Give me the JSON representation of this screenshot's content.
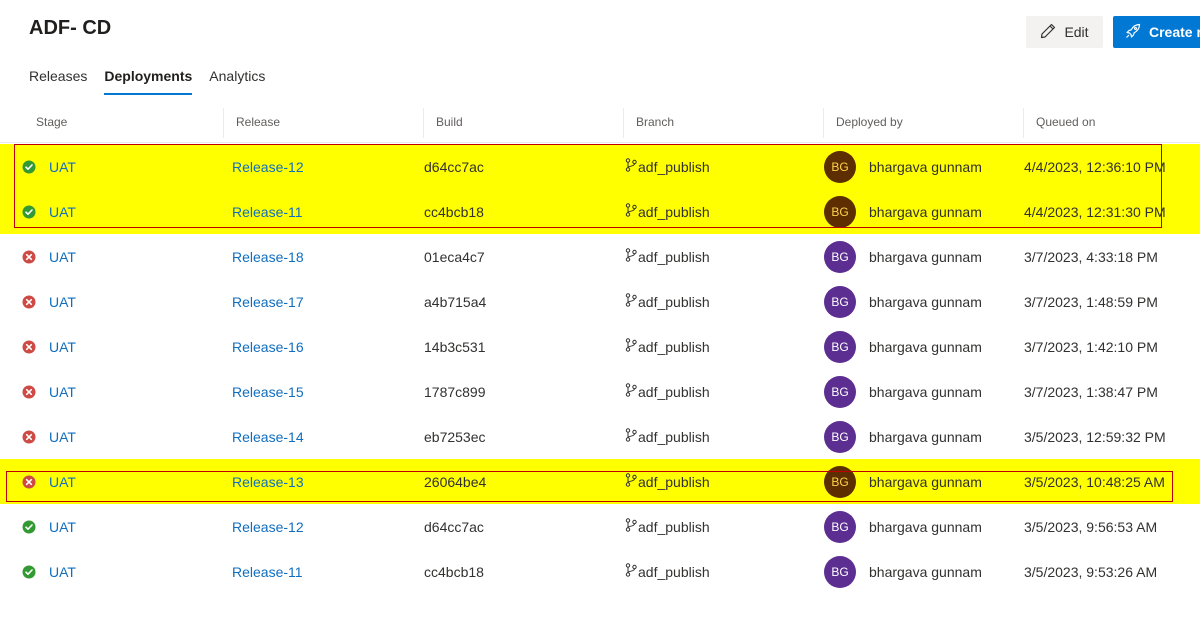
{
  "page": {
    "title": "ADF- CD"
  },
  "toolbar": {
    "edit_label": "Edit",
    "create_label": "Create release"
  },
  "tabs": [
    {
      "label": "Releases"
    },
    {
      "label": "Deployments"
    },
    {
      "label": "Analytics"
    }
  ],
  "table": {
    "headers": [
      "Stage",
      "Release",
      "Build",
      "Branch",
      "Deployed by",
      "Queued on"
    ],
    "rows": [
      {
        "status": "succeeded",
        "stage": "UAT",
        "release": "Release-12",
        "build": "d64cc7ac",
        "branch": "adf_publish",
        "initials": "BG",
        "deployed_by": "bhargava gunnam",
        "queued_on": "4/4/2023, 12:36:10 PM",
        "highlighted": true
      },
      {
        "status": "succeeded",
        "stage": "UAT",
        "release": "Release-11",
        "build": "cc4bcb18",
        "branch": "adf_publish",
        "initials": "BG",
        "deployed_by": "bhargava gunnam",
        "queued_on": "4/4/2023, 12:31:30 PM",
        "highlighted": true
      },
      {
        "status": "failed",
        "stage": "UAT",
        "release": "Release-18",
        "build": "01eca4c7",
        "branch": "adf_publish",
        "initials": "BG",
        "deployed_by": "bhargava gunnam",
        "queued_on": "3/7/2023, 4:33:18 PM",
        "highlighted": false
      },
      {
        "status": "failed",
        "stage": "UAT",
        "release": "Release-17",
        "build": "a4b715a4",
        "branch": "adf_publish",
        "initials": "BG",
        "deployed_by": "bhargava gunnam",
        "queued_on": "3/7/2023, 1:48:59 PM",
        "highlighted": false
      },
      {
        "status": "failed",
        "stage": "UAT",
        "release": "Release-16",
        "build": "14b3c531",
        "branch": "adf_publish",
        "initials": "BG",
        "deployed_by": "bhargava gunnam",
        "queued_on": "3/7/2023, 1:42:10 PM",
        "highlighted": false
      },
      {
        "status": "failed",
        "stage": "UAT",
        "release": "Release-15",
        "build": "1787c899",
        "branch": "adf_publish",
        "initials": "BG",
        "deployed_by": "bhargava gunnam",
        "queued_on": "3/7/2023, 1:38:47 PM",
        "highlighted": false
      },
      {
        "status": "failed",
        "stage": "UAT",
        "release": "Release-14",
        "build": "eb7253ec",
        "branch": "adf_publish",
        "initials": "BG",
        "deployed_by": "bhargava gunnam",
        "queued_on": "3/5/2023, 12:59:32 PM",
        "highlighted": false
      },
      {
        "status": "failed",
        "stage": "UAT",
        "release": "Release-13",
        "build": "26064be4",
        "branch": "adf_publish",
        "initials": "BG",
        "deployed_by": "bhargava gunnam",
        "queued_on": "3/5/2023, 10:48:25 AM",
        "highlighted": true
      },
      {
        "status": "succeeded",
        "stage": "UAT",
        "release": "Release-12",
        "build": "d64cc7ac",
        "branch": "adf_publish",
        "initials": "BG",
        "deployed_by": "bhargava gunnam",
        "queued_on": "3/5/2023, 9:56:53 AM",
        "highlighted": false
      },
      {
        "status": "succeeded",
        "stage": "UAT",
        "release": "Release-11",
        "build": "cc4bcb18",
        "branch": "adf_publish",
        "initials": "BG",
        "deployed_by": "bhargava gunnam",
        "queued_on": "3/5/2023, 9:53:26 AM",
        "highlighted": false
      }
    ]
  },
  "colors": {
    "accent": "#0078d4",
    "link": "#106ebe",
    "success": "#339933",
    "failure": "#cd4a45",
    "highlight": "#ffff00",
    "annotation_border": "#c00000",
    "avatar": "#5c2e91"
  }
}
